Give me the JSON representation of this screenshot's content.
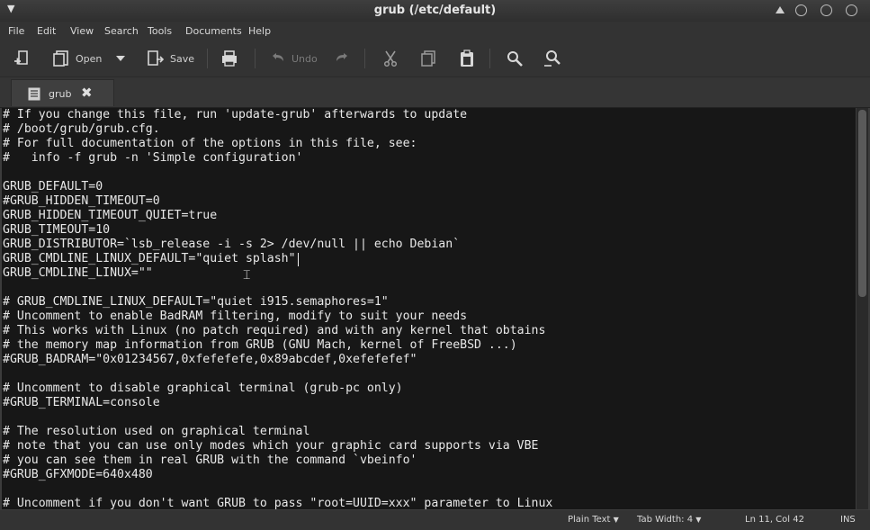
{
  "window": {
    "title": "grub (/etc/default)"
  },
  "menubar": {
    "items": [
      "File",
      "Edit",
      "View",
      "Search",
      "Tools",
      "Documents",
      "Help"
    ]
  },
  "toolbar": {
    "open_label": "Open",
    "save_label": "Save",
    "undo_label": "Undo"
  },
  "tab": {
    "label": "grub"
  },
  "editor": {
    "lines": [
      "# If you change this file, run 'update-grub' afterwards to update",
      "# /boot/grub/grub.cfg.",
      "# For full documentation of the options in this file, see:",
      "#   info -f grub -n 'Simple configuration'",
      "",
      "GRUB_DEFAULT=0",
      "#GRUB_HIDDEN_TIMEOUT=0",
      "GRUB_HIDDEN_TIMEOUT_QUIET=true",
      "GRUB_TIMEOUT=10",
      "GRUB_DISTRIBUTOR=`lsb_release -i -s 2> /dev/null || echo Debian`",
      "GRUB_CMDLINE_LINUX_DEFAULT=\"quiet splash\"",
      "GRUB_CMDLINE_LINUX=\"\"",
      "",
      "# GRUB_CMDLINE_LINUX_DEFAULT=\"quiet i915.semaphores=1\"",
      "# Uncomment to enable BadRAM filtering, modify to suit your needs",
      "# This works with Linux (no patch required) and with any kernel that obtains",
      "# the memory map information from GRUB (GNU Mach, kernel of FreeBSD ...)",
      "#GRUB_BADRAM=\"0x01234567,0xfefefefe,0x89abcdef,0xefefefef\"",
      "",
      "# Uncomment to disable graphical terminal (grub-pc only)",
      "#GRUB_TERMINAL=console",
      "",
      "# The resolution used on graphical terminal",
      "# note that you can use only modes which your graphic card supports via VBE",
      "# you can see them in real GRUB with the command `vbeinfo'",
      "#GRUB_GFXMODE=640x480",
      "",
      "# Uncomment if you don't want GRUB to pass \"root=UUID=xxx\" parameter to Linux"
    ]
  },
  "statusbar": {
    "language": "Plain Text",
    "tab_width_label": "Tab Width:",
    "tab_width_value": "4",
    "position": "Ln 11, Col 42",
    "mode": "INS"
  }
}
